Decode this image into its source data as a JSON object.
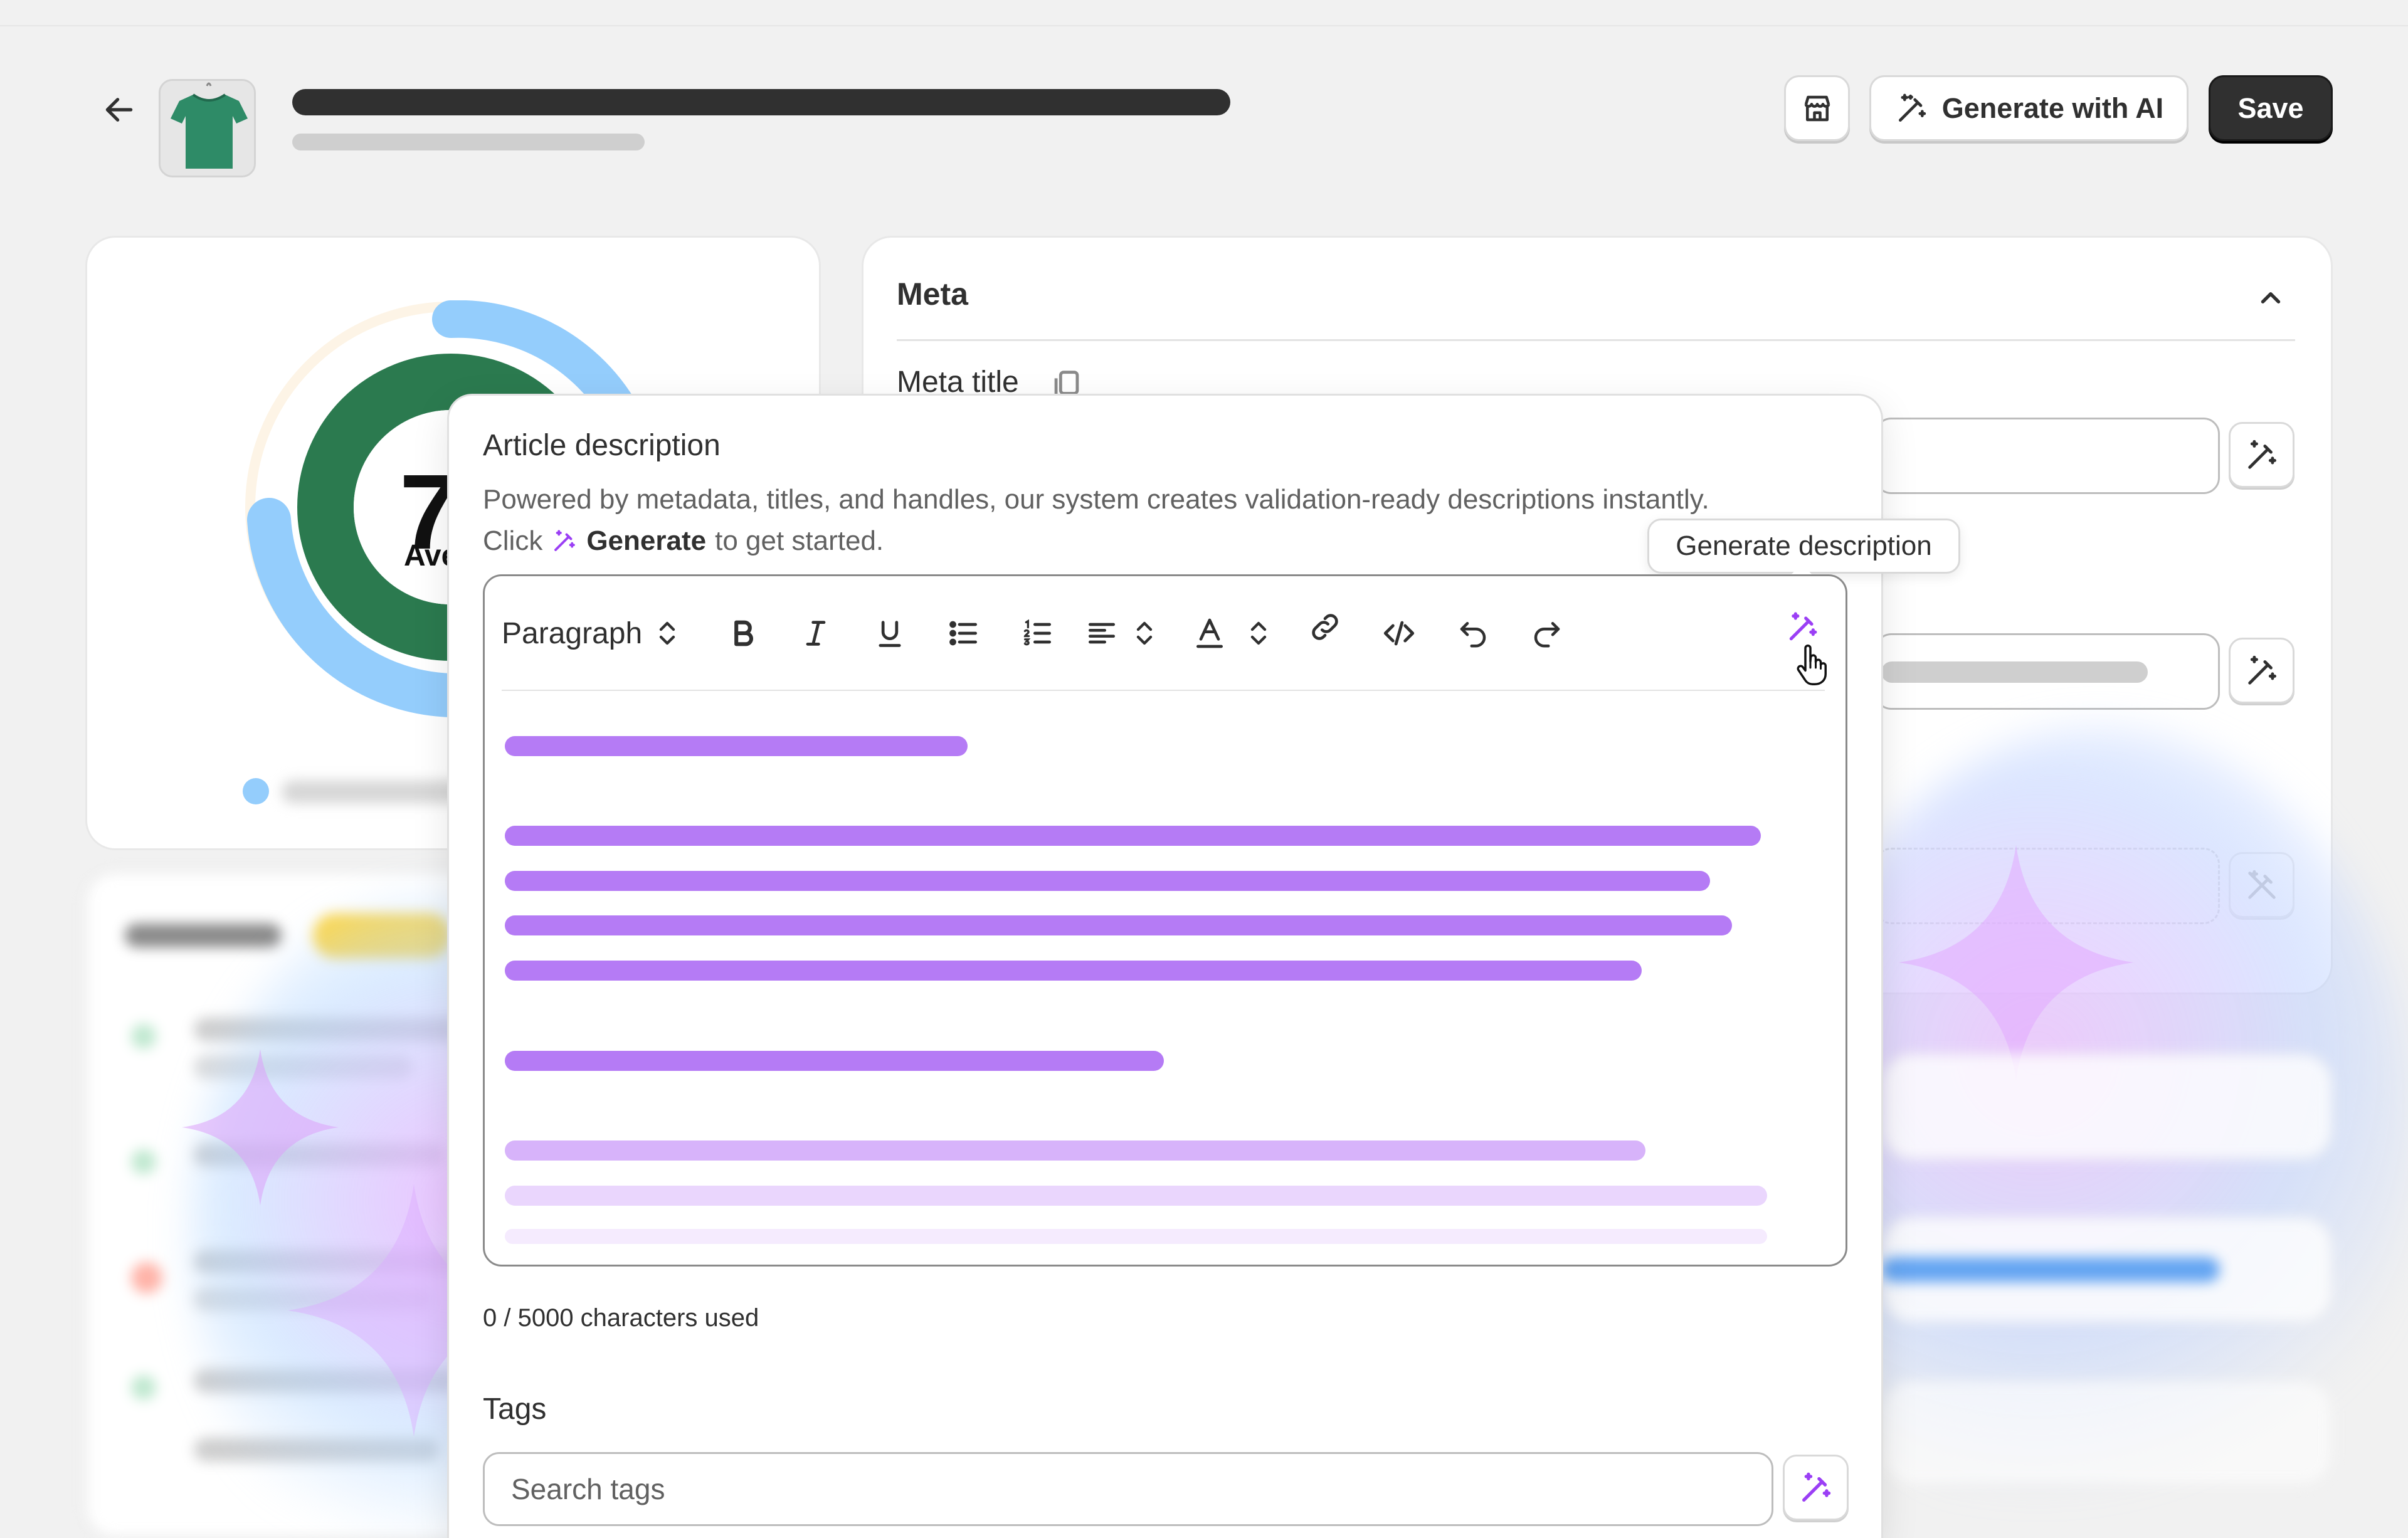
{
  "header": {
    "back_icon": "arrow-left-icon",
    "store_icon": "storefront-icon",
    "generate_ai_label": "Generate with AI",
    "save_label": "Save"
  },
  "score": {
    "value_partial": "7",
    "label_partial": "Ave"
  },
  "meta": {
    "heading": "Meta",
    "meta_title_label": "Meta title"
  },
  "article": {
    "title": "Article description",
    "desc_line1": "Powered by metadata, titles, and handles, our system creates validation-ready descriptions instantly.",
    "desc_click": "Click",
    "desc_generate": "Generate",
    "desc_rest": "to get started.",
    "toolbar": {
      "paragraph_label": "Paragraph"
    },
    "tooltip": "Generate description",
    "char_count": "0 / 5000 characters used"
  },
  "tags": {
    "label": "Tags",
    "placeholder": "Search tags"
  },
  "colors": {
    "accent_purple": "#b57bf5",
    "score_green": "#2b7a4f",
    "score_blue": "#94cdfc",
    "primary_dark": "#303030"
  }
}
